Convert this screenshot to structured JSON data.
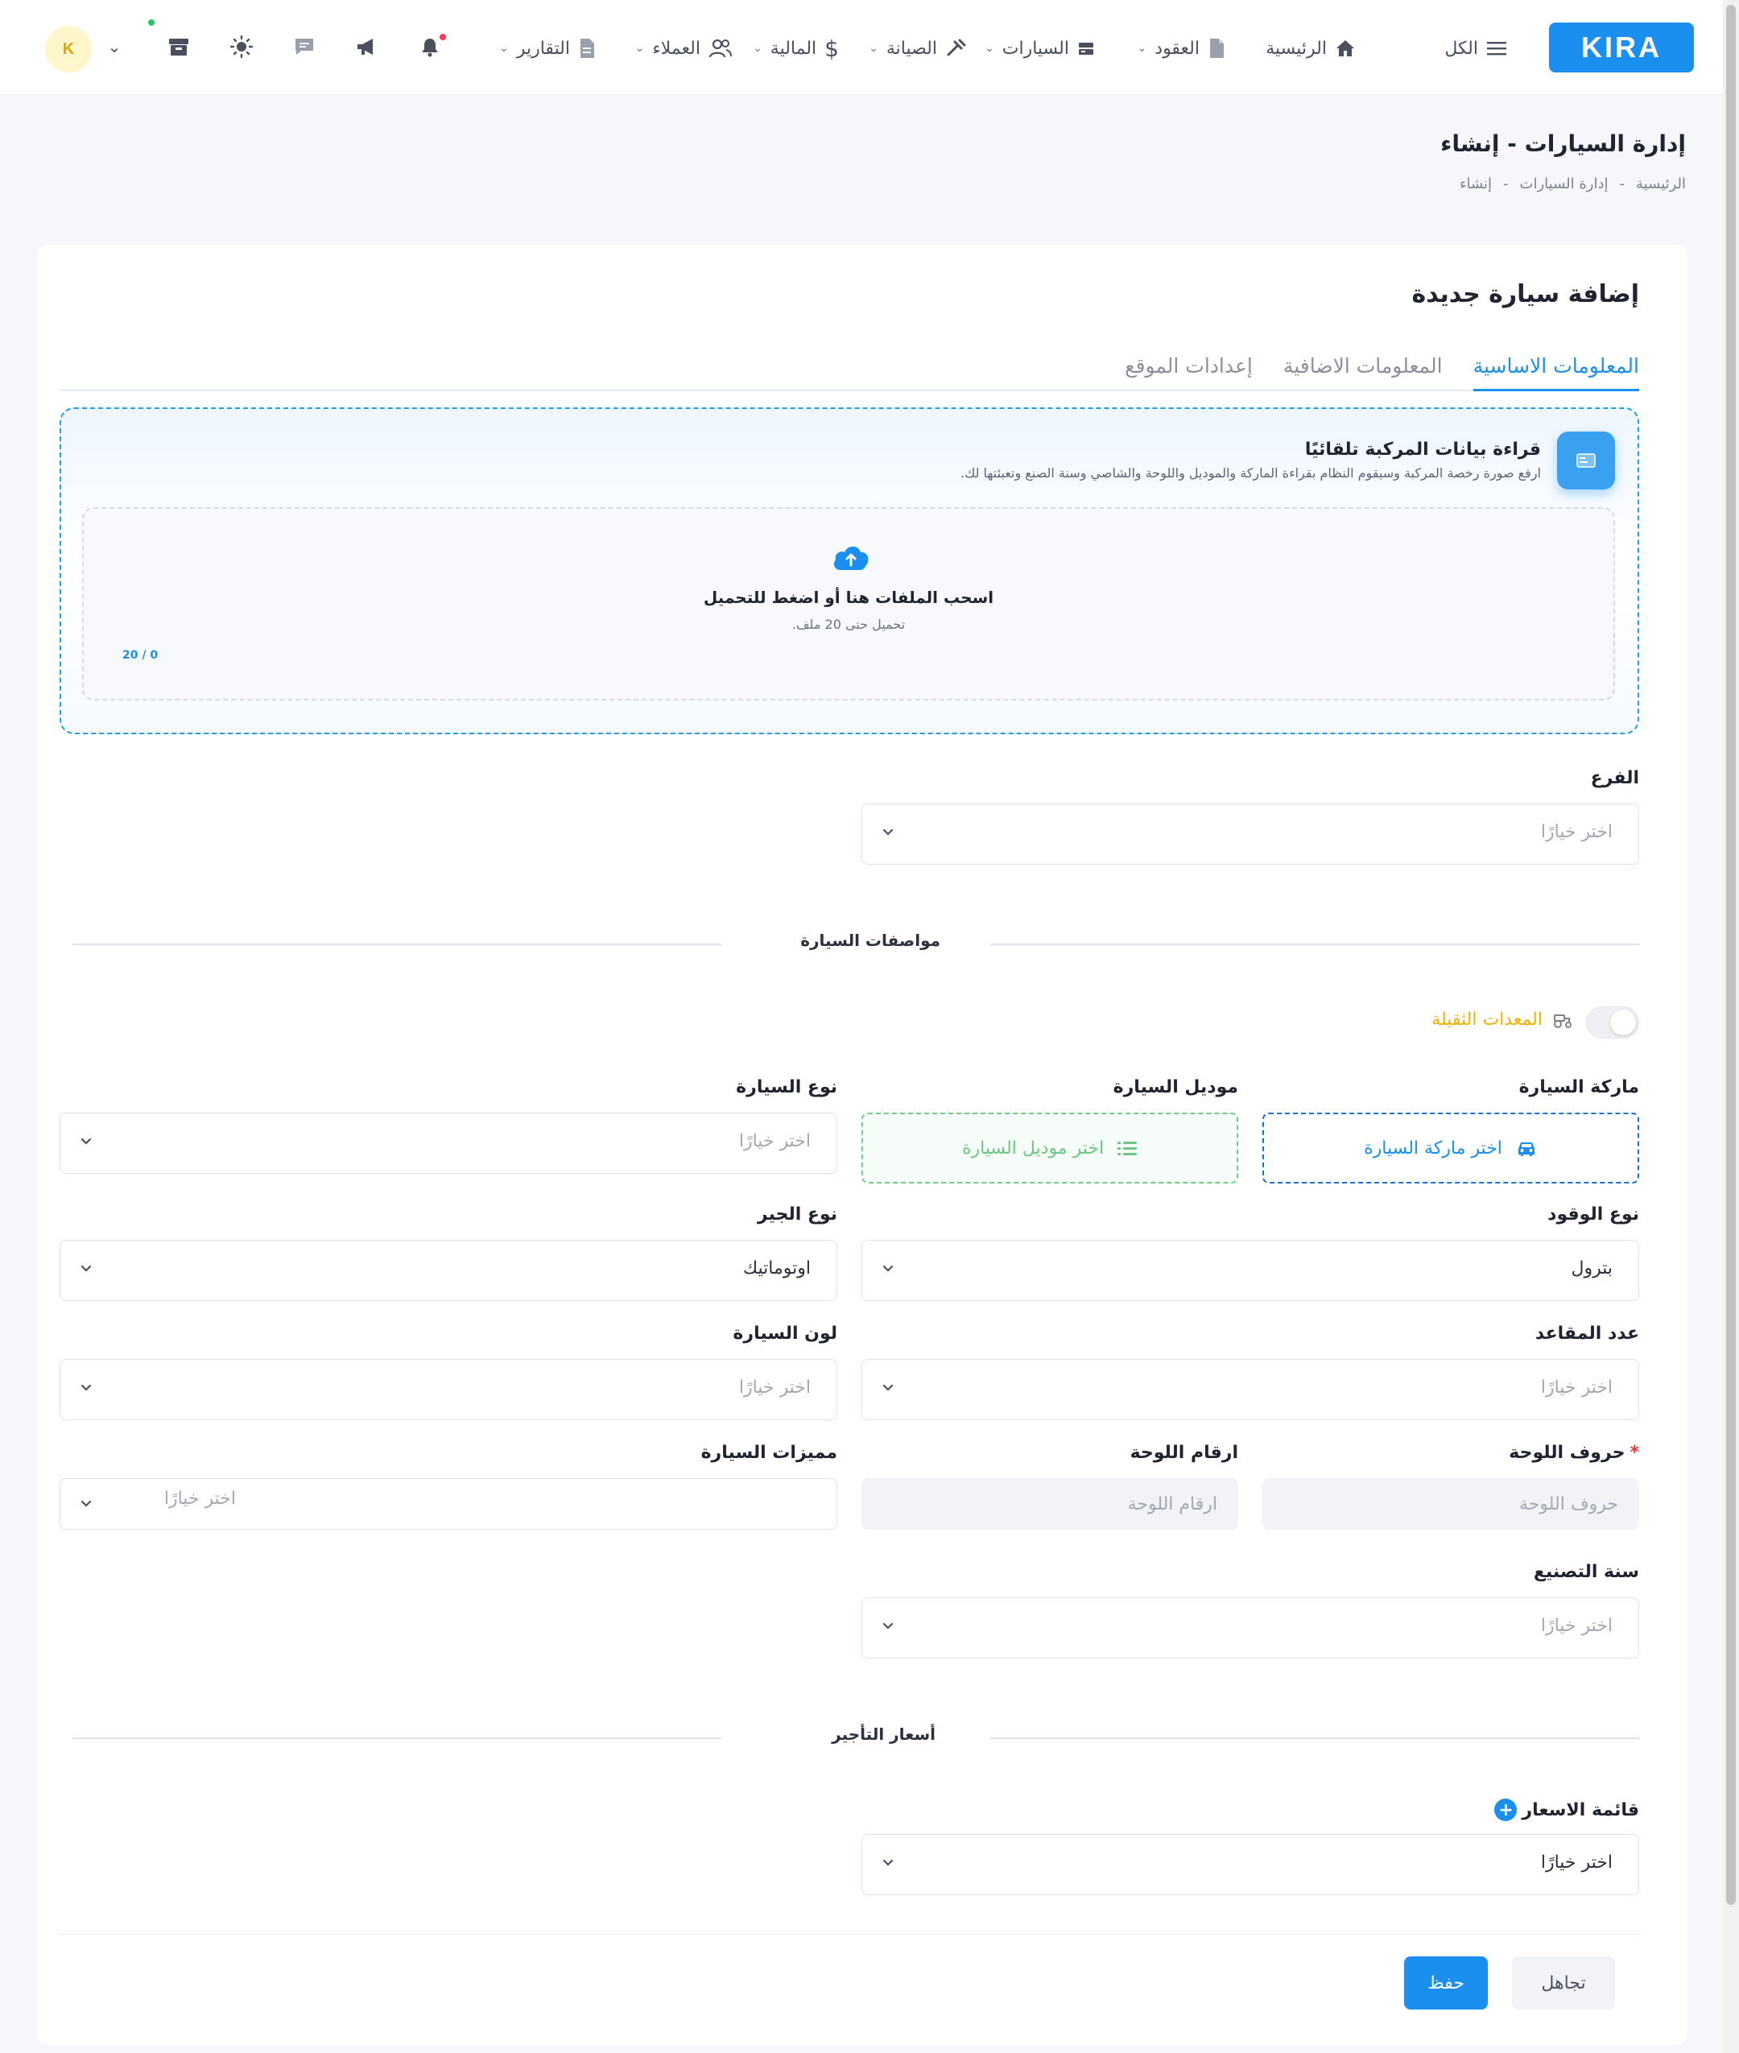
{
  "app": {
    "logo": "KIRA",
    "avatar_letter": "K"
  },
  "nav": {
    "all": "الكل",
    "items": [
      {
        "label": "الرئيسية",
        "icon": "home-icon",
        "has_menu": false
      },
      {
        "label": "العقود",
        "icon": "document-icon",
        "has_menu": true
      },
      {
        "label": "السيارات",
        "icon": "car-card-icon",
        "has_menu": true
      },
      {
        "label": "الصيانة",
        "icon": "wrench-icon",
        "has_menu": true
      },
      {
        "label": "المالية",
        "icon": "dollar-icon",
        "has_menu": true
      },
      {
        "label": "العملاء",
        "icon": "users-icon",
        "has_menu": true
      },
      {
        "label": "التقارير",
        "icon": "report-icon",
        "has_menu": true
      }
    ]
  },
  "page": {
    "title": "إدارة السيارات - إنشاء",
    "breadcrumb": [
      "الرئيسية",
      "-",
      "إدارة السيارات",
      "-",
      "إنشاء"
    ]
  },
  "card": {
    "title": "إضافة سيارة جديدة",
    "tabs": [
      "المعلومات الاساسية",
      "المعلومات الاضافية",
      "إعدادات الموقع"
    ],
    "active_tab": "المعلومات الاساسية"
  },
  "ocr": {
    "title": "قراءة بيانات المركبة تلقائيًا",
    "subtitle": "ارفع صورة رخصة المركبة وسيقوم النظام بقراءة الماركة والموديل واللوحة والشاصي وسنة الصنع وتعبئتها لك.",
    "drop_title": "اسحب الملفات هنا أو اضغط للتحميل",
    "drop_sub": "تحميل حتى 20 ملف.",
    "count": "20 / 0"
  },
  "form": {
    "branch": {
      "label": "الفرع",
      "placeholder": "اختر خيارًا"
    },
    "specs_divider": "مواصفات السيارة",
    "heavy_label": "المعدات الثقيلة",
    "brand": {
      "label": "ماركة السيارة",
      "button": "اختر ماركة السيارة"
    },
    "model": {
      "label": "موديل السيارة",
      "button": "اختر موديل السيارة"
    },
    "car_type": {
      "label": "نوع السيارة",
      "placeholder": "اختر خيارًا"
    },
    "fuel": {
      "label": "نوع الوقود",
      "value": "بترول"
    },
    "gear": {
      "label": "نوع الجير",
      "value": "اوتوماتيك"
    },
    "seats": {
      "label": "عدد المقاعد",
      "placeholder": "اختر خيارًا"
    },
    "color": {
      "label": "لون السيارة",
      "placeholder": "اختر خيارًا"
    },
    "plate_letters": {
      "label": "حروف اللوحة",
      "required": "*",
      "placeholder": "حروف اللوحة"
    },
    "plate_numbers": {
      "label": "ارقام اللوحة",
      "placeholder": "ارقام اللوحة"
    },
    "features": {
      "label": "مميزات السيارة",
      "placeholder": "اختر خيارًا"
    },
    "year": {
      "label": "سنة التصنيع",
      "placeholder": "اختر خيارًا"
    },
    "prices_divider": "أسعار التأجير",
    "price_list": {
      "label": "قائمة الاسعار",
      "value": "اختر خيارًا"
    }
  },
  "actions": {
    "save": "حفظ",
    "ignore": "تجاهل"
  },
  "colors": {
    "accent": "#1a8ff0",
    "warning": "#f0b400",
    "success": "#6cc883"
  }
}
